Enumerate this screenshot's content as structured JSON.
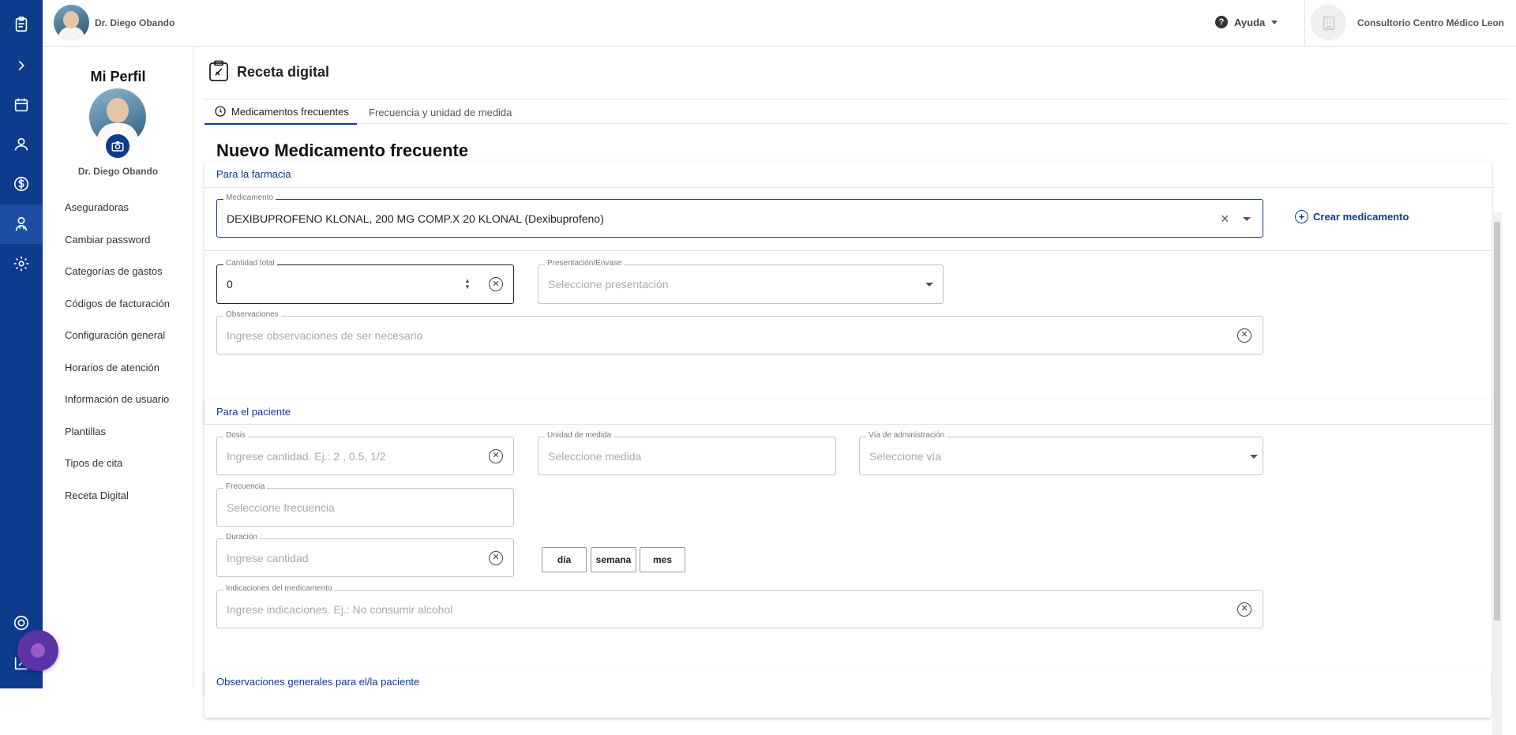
{
  "topbar": {
    "user_name": "Dr. Diego Obando",
    "help_label": "Ayuda",
    "clinic_name": "Consultorio Centro Médico Leon"
  },
  "sidebar": {
    "title": "Mi Perfil",
    "user_name": "Dr. Diego Obando",
    "items": [
      {
        "label": "Aseguradoras"
      },
      {
        "label": "Cambiar password"
      },
      {
        "label": "Categorías de gastos"
      },
      {
        "label": "Códigos de facturación"
      },
      {
        "label": "Configuración general"
      },
      {
        "label": "Horarios de atención"
      },
      {
        "label": "Información de usuario"
      },
      {
        "label": "Plantillas"
      },
      {
        "label": "Tipos de cita"
      },
      {
        "label": "Receta Digital"
      }
    ]
  },
  "rail_icons": [
    "clipboard-icon",
    "chevron-right-icon",
    "calendar-icon",
    "patients-icon",
    "dollar-icon",
    "doctor-icon",
    "settings-icon",
    "support-icon",
    "logout-icon"
  ],
  "page": {
    "title": "Receta digital",
    "tabs": [
      {
        "label": "Medicamentos frecuentes",
        "active": true
      },
      {
        "label": "Frecuencia y unidad de medida",
        "active": false
      }
    ],
    "section_title": "Nuevo Medicamento frecuente"
  },
  "pharmacy": {
    "header": "Para la farmacia",
    "medicamento": {
      "label": "Medicamento",
      "value": "DEXIBUPROFENO KLONAL, 200 MG COMP.X 20 KLONAL (Dexibuprofeno)"
    },
    "create_label": "Crear medicamento",
    "cantidad": {
      "label": "Cantidad total",
      "value": "0"
    },
    "presentacion": {
      "label": "Presentación/Envase",
      "placeholder": "Seleccione presentación"
    },
    "observaciones": {
      "label": "Observaciones",
      "placeholder": "Ingrese observaciones de ser necesario"
    }
  },
  "patient": {
    "header": "Para el paciente",
    "dosis": {
      "label": "Dosis",
      "placeholder": "Ingrese cantidad. Ej.: 2 , 0.5, 1/2"
    },
    "unidad": {
      "label": "Unidad de medida",
      "placeholder": "Seleccione medida"
    },
    "via": {
      "label": "Vía de administración",
      "placeholder": "Seleccione vía"
    },
    "frecuencia": {
      "label": "Frecuencia",
      "placeholder": "Seleccione frecuencia"
    },
    "duracion": {
      "label": "Duración",
      "placeholder": "Ingrese cantidad"
    },
    "duration_units": [
      "día",
      "semana",
      "mes"
    ],
    "indicaciones": {
      "label": "Indicaciones del medicamento",
      "placeholder": "Ingrese indicaciones. Ej.: No consumir alcohol"
    }
  },
  "general": {
    "header": "Observaciones generales para el/la paciente"
  },
  "colors": {
    "primary": "#0e3b8e",
    "fab": "#5a33a6"
  }
}
